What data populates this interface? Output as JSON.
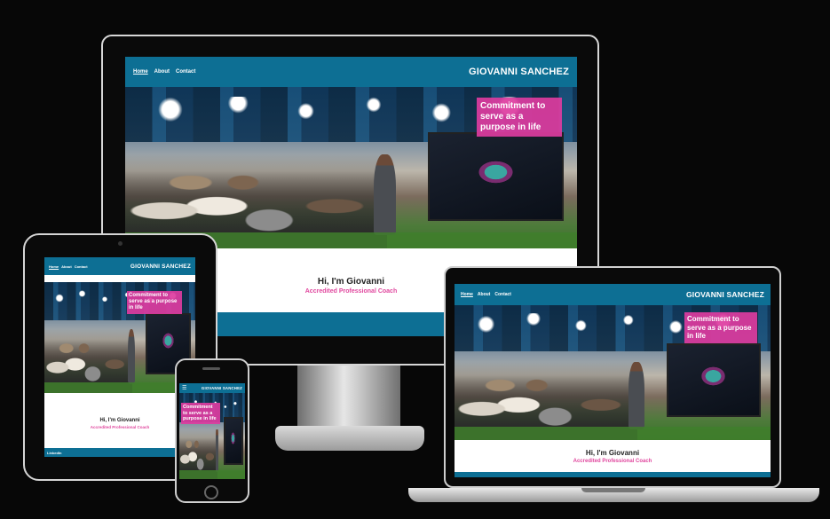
{
  "site": {
    "nav_links": [
      "Home",
      "About",
      "Contact"
    ],
    "brand": "GIOVANNI SANCHEZ",
    "tagline": "Commitment to serve as a purpose in life",
    "greeting": "Hi, I'm Giovanni",
    "role": "Accredited Professional Coach",
    "footer_link": "LinkedIn",
    "menu_icon": "hamburger-menu-icon"
  },
  "colors": {
    "background": "#070707",
    "nav": "#0d6f94",
    "accent_pink": "#e0479e",
    "device_frame": "#d7d7d7"
  },
  "devices": [
    "desktop",
    "laptop",
    "tablet",
    "phone"
  ]
}
